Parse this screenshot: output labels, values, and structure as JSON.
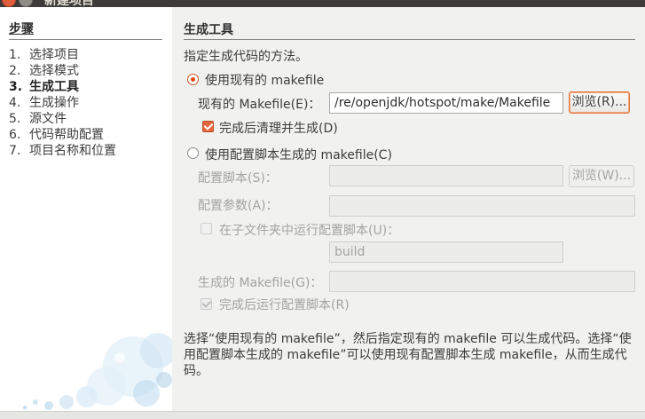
{
  "window": {
    "title": "新建项目"
  },
  "steps": {
    "title": "步骤",
    "items": [
      {
        "num": "1.",
        "label": "选择项目"
      },
      {
        "num": "2.",
        "label": "选择模式"
      },
      {
        "num": "3.",
        "label": "生成工具"
      },
      {
        "num": "4.",
        "label": "生成操作"
      },
      {
        "num": "5.",
        "label": "源文件"
      },
      {
        "num": "6.",
        "label": "代码帮助配置"
      },
      {
        "num": "7.",
        "label": "项目名称和位置"
      }
    ],
    "current_index": 2
  },
  "panel": {
    "title": "生成工具",
    "description": "指定生成代码的方法。",
    "existing": {
      "radio_label": "使用现有的 makefile",
      "makefile_label": "现有的 Makefile(E)：",
      "makefile_value": "/re/openjdk/hotspot/make/Makefile",
      "browse_label": "浏览(R)...",
      "clean_label": "完成后清理并生成(D)"
    },
    "configure": {
      "radio_label": "使用配置脚本生成的 makefile(C)",
      "script_label": "配置脚本(S)：",
      "script_value": "",
      "browse_label": "浏览(W)...",
      "args_label": "配置参数(A)：",
      "args_value": "",
      "subfolder_label": "在子文件夹中运行配置脚本(U)：",
      "subfolder_value": "build",
      "generated_label": "生成的 Makefile(G)：",
      "generated_value": "",
      "run_after_label": "完成后运行配置脚本(R)"
    },
    "help_text": "选择“使用现有的 makefile”，然后指定现有的 makefile 可以生成代码。选择“使用配置脚本生成的 makefile”可以使用现有配置脚本生成 makefile，从而生成代码。"
  },
  "colors": {
    "accent": "#dd4814",
    "panel_bg": "#f1f1ef",
    "sidebar_bg": "#ffffff"
  }
}
